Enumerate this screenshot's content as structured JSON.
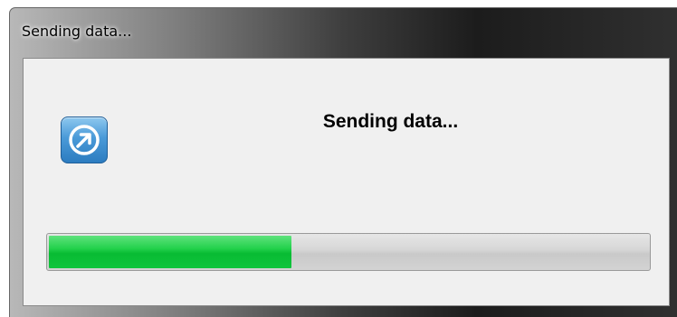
{
  "window": {
    "title": "Sending data..."
  },
  "dialog": {
    "message": "Sending data...",
    "icon": "send-arrow-icon",
    "progress_fraction": 0.405
  },
  "colors": {
    "progress_fill": "#0fc53c",
    "progress_track": "#d3d3d3",
    "icon_blue": "#3a8ccc",
    "client_background": "#f0f0f0"
  }
}
